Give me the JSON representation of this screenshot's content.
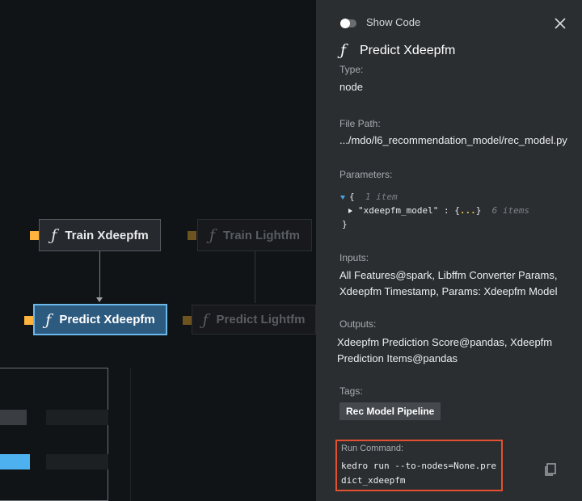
{
  "canvas": {
    "nodes": {
      "train_xdeepfm": "Train Xdeepfm",
      "predict_xdeepfm": "Predict Xdeepfm",
      "train_lightfm": "Train Lightfm",
      "predict_lightfm": "Predict Lightfm"
    },
    "function_glyph": "ƒ"
  },
  "panel": {
    "show_code_label": "Show Code",
    "node_icon": "function-icon",
    "title": "Predict Xdeepfm",
    "type_label": "Type:",
    "type_value": "node",
    "file_path_label": "File Path:",
    "file_path_value": ".../mdo/l6_recommendation_model/rec_model.py",
    "parameters_label": "Parameters:",
    "parameters": {
      "open_brace": "{",
      "count_comment": "1 item",
      "key": "\"xdeepfm_model\"",
      "colon": ":",
      "value_open": "{",
      "ellipsis": "...",
      "value_close": "}",
      "value_count_comment": "6 items",
      "close_brace": "}"
    },
    "inputs_label": "Inputs:",
    "inputs_value": "All Features@spark,   Libffm Converter Params, Xdeepfm Timestamp,   Params: Xdeepfm Model",
    "outputs_label": "Outputs:",
    "outputs_value": "Xdeepfm Prediction Score@pandas,   Xdeepfm Prediction Items@pandas",
    "tags_label": "Tags:",
    "tag": "Rec Model Pipeline",
    "run_command_label": "Run Command:",
    "run_command": "kedro run --to-nodes=None.predict_xdeepfm"
  },
  "colors": {
    "selected_node": "#2d5a7f",
    "selected_border": "#6bb8ea",
    "parameter_marker": "#ffb23c",
    "highlight_box": "#e4502f"
  }
}
